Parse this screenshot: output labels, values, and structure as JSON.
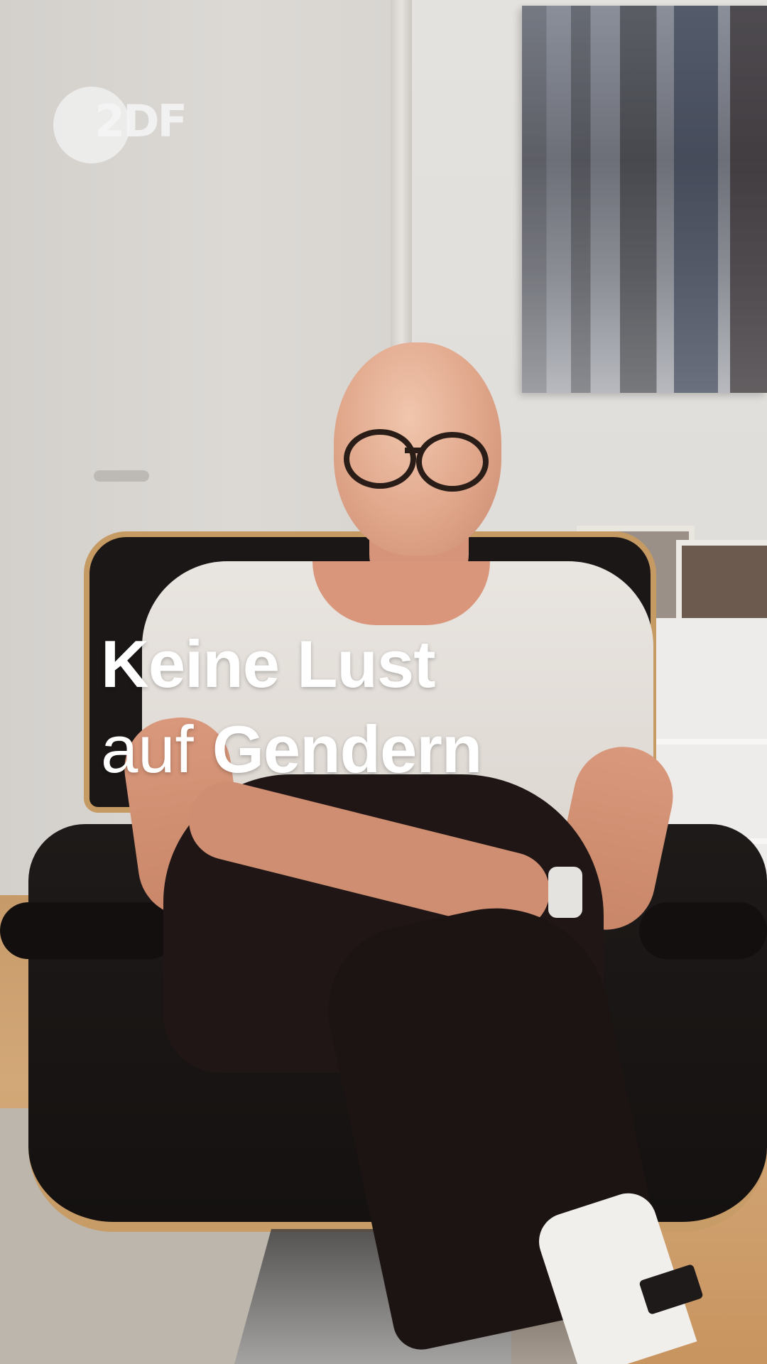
{
  "branding": {
    "logo_text": "2DF",
    "logo_name": "ZDF"
  },
  "headline": {
    "line1_bold": "Keine Lust",
    "line2_light": "auf",
    "line2_bold": "Gendern"
  },
  "colors": {
    "headline_text": "#ffffff",
    "logo": "#f0f0f0"
  }
}
